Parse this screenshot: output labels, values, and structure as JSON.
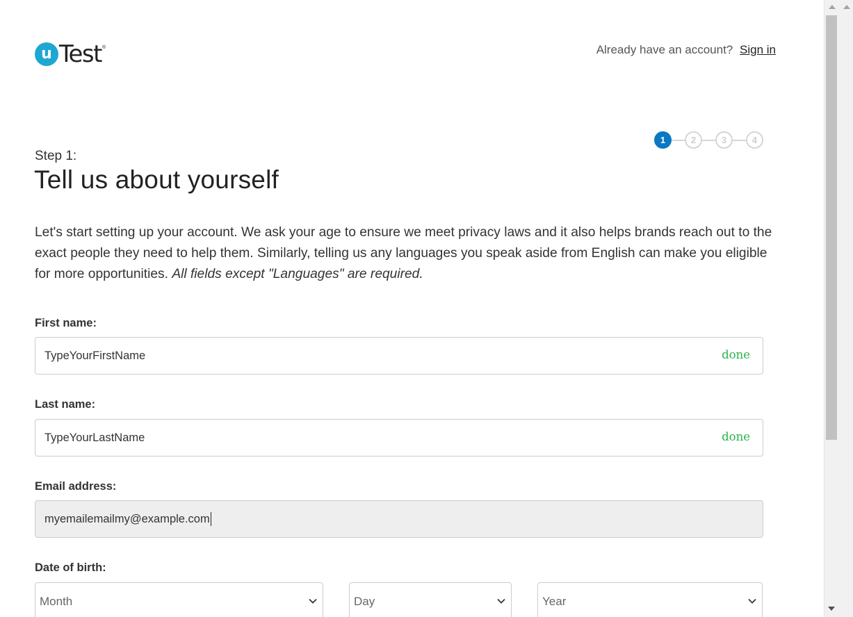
{
  "header": {
    "logo_letter": "u",
    "logo_text": "Test",
    "logo_mark": "®",
    "signin_prompt": "Already have an account?",
    "signin_link": "Sign in"
  },
  "stepper": {
    "steps": [
      "1",
      "2",
      "3",
      "4"
    ],
    "active_step": 1
  },
  "heading": {
    "step_label": "Step 1:",
    "title": "Tell us about yourself"
  },
  "intro": {
    "text": "Let's start setting up your account. We ask your age to ensure we meet privacy laws and it also helps brands reach out to the exact people they need to help them. Similarly, telling us any languages you speak aside from English can make you eligible for more opportunities. ",
    "emphasis": "All fields except \"Languages\" are required."
  },
  "form": {
    "first_name": {
      "label": "First name:",
      "value": "TypeYourFirstName",
      "status": "done"
    },
    "last_name": {
      "label": "Last name:",
      "value": "TypeYourLastName",
      "status": "done"
    },
    "email": {
      "label": "Email address:",
      "value": "myemailemailmy@example.com"
    },
    "dob": {
      "label": "Date of birth:",
      "month": "Month",
      "day": "Day",
      "year": "Year"
    }
  },
  "colors": {
    "accent": "#0a78c2",
    "logo": "#1ea7d1",
    "valid": "#27b34a"
  }
}
